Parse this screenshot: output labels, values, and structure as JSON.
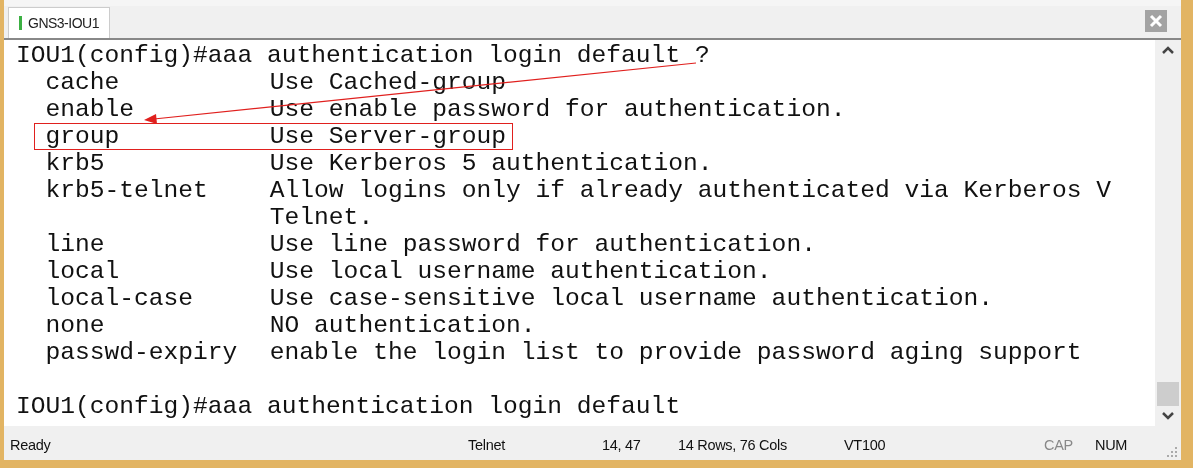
{
  "tabs": [
    {
      "label": "GNS3-IOU1",
      "selected": true
    }
  ],
  "terminal": {
    "lines": [
      {
        "kind": "prompt",
        "text": "IOU1(config)#aaa authentication login default ?"
      },
      {
        "kind": "option",
        "keyword": "cache",
        "description": "Use Cached-group",
        "highlighted": false
      },
      {
        "kind": "option",
        "keyword": "enable",
        "description": "Use enable password for authentication.",
        "highlighted": false
      },
      {
        "kind": "option",
        "keyword": "group",
        "description": "Use Server-group",
        "highlighted": true
      },
      {
        "kind": "option",
        "keyword": "krb5",
        "description": "Use Kerberos 5 authentication.",
        "highlighted": false
      },
      {
        "kind": "option",
        "keyword": "krb5-telnet",
        "description": "Allow logins only if already authenticated via Kerberos V",
        "highlighted": false
      },
      {
        "kind": "continuation",
        "description": "Telnet."
      },
      {
        "kind": "option",
        "keyword": "line",
        "description": "Use line password for authentication.",
        "highlighted": false
      },
      {
        "kind": "option",
        "keyword": "local",
        "description": "Use local username authentication.",
        "highlighted": false
      },
      {
        "kind": "option",
        "keyword": "local-case",
        "description": "Use case-sensitive local username authentication.",
        "highlighted": false
      },
      {
        "kind": "option",
        "keyword": "none",
        "description": "NO authentication.",
        "highlighted": false
      },
      {
        "kind": "option",
        "keyword": "passwd-expiry",
        "description": "enable the login list to provide password aging support",
        "highlighted": false
      },
      {
        "kind": "blank"
      },
      {
        "kind": "prompt",
        "text": "IOU1(config)#aaa authentication login default"
      }
    ]
  },
  "status_bar": {
    "message": "Ready",
    "protocol": "Telnet",
    "cursor": "14,  47",
    "size": "14 Rows,  76 Cols",
    "emulation": "VT100",
    "indicators": [
      {
        "label": "CAP",
        "on": false
      },
      {
        "label": "NUM",
        "on": true
      }
    ]
  }
}
